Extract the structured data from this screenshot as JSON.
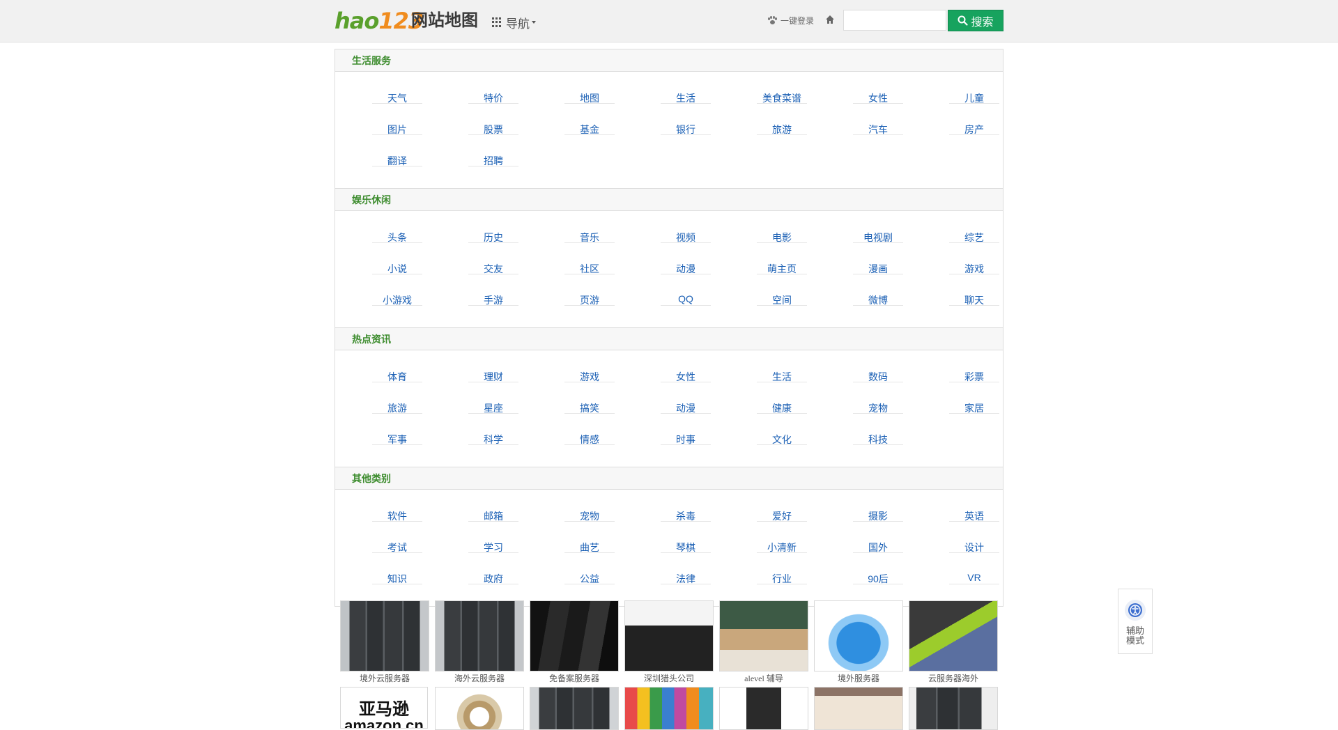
{
  "header": {
    "logo_hao": "hao",
    "logo_123": "123",
    "site_title": "网站地图",
    "nav_label": "导航",
    "login_label": "一键登录",
    "search_placeholder": "",
    "search_button": "搜索"
  },
  "sections": [
    {
      "title": "生活服务",
      "links": [
        "天气",
        "特价",
        "地图",
        "生活",
        "美食菜谱",
        "女性",
        "儿童",
        "图片",
        "股票",
        "基金",
        "银行",
        "旅游",
        "汽车",
        "房产",
        "翻译",
        "招聘"
      ]
    },
    {
      "title": "娱乐休闲",
      "links": [
        "头条",
        "历史",
        "音乐",
        "视频",
        "电影",
        "电视剧",
        "综艺",
        "小说",
        "交友",
        "社区",
        "动漫",
        "萌主页",
        "漫画",
        "游戏",
        "小游戏",
        "手游",
        "页游",
        "QQ",
        "空间",
        "微博",
        "聊天"
      ]
    },
    {
      "title": "热点资讯",
      "links": [
        "体育",
        "理财",
        "游戏",
        "女性",
        "生活",
        "数码",
        "彩票",
        "旅游",
        "星座",
        "搞笑",
        "动漫",
        "健康",
        "宠物",
        "家居",
        "军事",
        "科学",
        "情感",
        "时事",
        "文化",
        "科技"
      ]
    },
    {
      "title": "其他类别",
      "links": [
        "软件",
        "邮箱",
        "宠物",
        "杀毒",
        "爱好",
        "摄影",
        "英语",
        "考试",
        "学习",
        "曲艺",
        "琴棋",
        "小清新",
        "国外",
        "设计",
        "知识",
        "政府",
        "公益",
        "法律",
        "行业",
        "90后",
        "VR"
      ]
    }
  ],
  "ads_row1": [
    "境外云服务器",
    "海外云服务器",
    "免备案服务器",
    "深圳猎头公司",
    "alevel 辅导",
    "境外服务器",
    "云服务器海外"
  ],
  "ads_row2_logo_text": [
    "亚马逊",
    "amazon.cn"
  ],
  "assist": {
    "line1": "辅助",
    "line2": "模式"
  },
  "colors": {
    "accent_green": "#17a35e",
    "section_title": "#3d8c2e",
    "link_blue": "#1a5fb4"
  }
}
